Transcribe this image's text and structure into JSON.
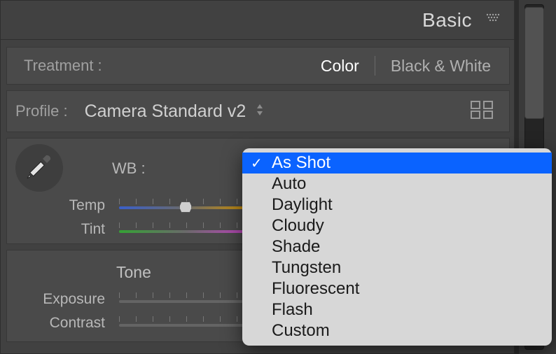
{
  "topbar": {
    "title": "Basic"
  },
  "treatment": {
    "label": "Treatment :",
    "color": "Color",
    "bw": "Black & White"
  },
  "profile": {
    "label": "Profile :",
    "value": "Camera Standard v2"
  },
  "wb": {
    "label": "WB :",
    "temp_label": "Temp",
    "tint_label": "Tint"
  },
  "tone": {
    "label": "Tone",
    "exposure_label": "Exposure",
    "contrast_label": "Contrast"
  },
  "dropdown": {
    "items": [
      {
        "label": "As Shot",
        "selected": true
      },
      {
        "label": "Auto",
        "selected": false
      },
      {
        "label": "Daylight",
        "selected": false
      },
      {
        "label": "Cloudy",
        "selected": false
      },
      {
        "label": "Shade",
        "selected": false
      },
      {
        "label": "Tungsten",
        "selected": false
      },
      {
        "label": "Fluorescent",
        "selected": false
      },
      {
        "label": "Flash",
        "selected": false
      },
      {
        "label": "Custom",
        "selected": false
      }
    ]
  }
}
